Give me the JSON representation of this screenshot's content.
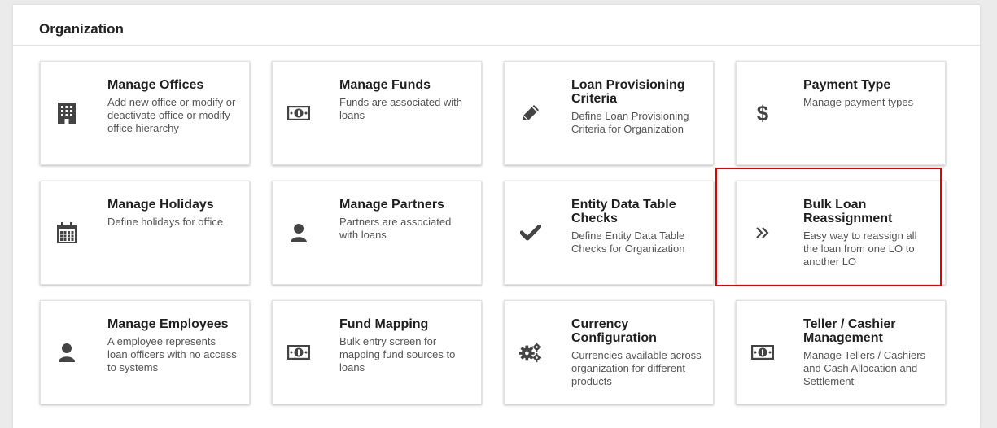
{
  "section": {
    "title": "Organization"
  },
  "colors": {
    "icon": "#444444",
    "highlight": "#e00000"
  },
  "cards": [
    {
      "title": "Manage Offices",
      "desc": "Add new office or modify or deactivate office or modify office hierarchy",
      "icon": "building-icon"
    },
    {
      "title": "Manage Funds",
      "desc": "Funds are associated with loans",
      "icon": "money-icon"
    },
    {
      "title": "Loan Provisioning Criteria",
      "desc": "Define Loan Provisioning Criteria for Organization",
      "icon": "pencil-icon"
    },
    {
      "title": "Payment Type",
      "desc": "Manage payment types",
      "icon": "dollar-icon"
    },
    {
      "title": "Manage Holidays",
      "desc": "Define holidays for office",
      "icon": "calendar-icon"
    },
    {
      "title": "Manage Partners",
      "desc": "Partners are associated with loans",
      "icon": "user-icon"
    },
    {
      "title": "Entity Data Table Checks",
      "desc": "Define Entity Data Table Checks for Organization",
      "icon": "check-icon"
    },
    {
      "title": "Bulk Loan Reassignment",
      "desc": "Easy way to reassign all the loan from one LO to another LO",
      "icon": "double-chevron-right-icon"
    },
    {
      "title": "Manage Employees",
      "desc": "A employee represents loan officers with no access to systems",
      "icon": "user-icon"
    },
    {
      "title": "Fund Mapping",
      "desc": "Bulk entry screen for mapping fund sources to loans",
      "icon": "money-icon"
    },
    {
      "title": "Currency Configuration",
      "desc": "Currencies available across organization for different products",
      "icon": "gears-icon"
    },
    {
      "title": "Teller / Cashier Management",
      "desc": "Manage Tellers / Cashiers and Cash Allocation and Settlement",
      "icon": "money-icon"
    }
  ]
}
